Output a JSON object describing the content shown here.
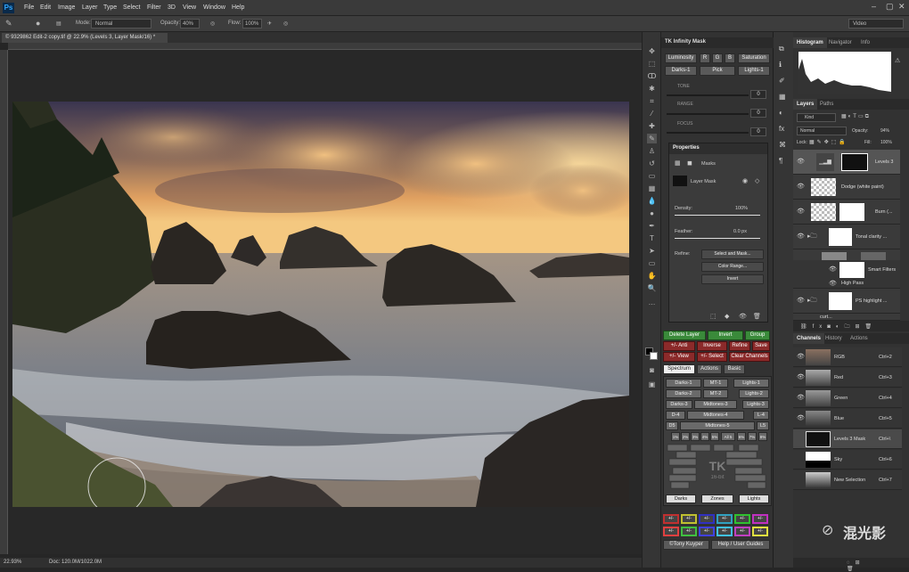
{
  "app": {
    "logo": "Ps"
  },
  "menu": [
    "File",
    "Edit",
    "Image",
    "Layer",
    "Type",
    "Select",
    "Filter",
    "3D",
    "View",
    "Window",
    "Help"
  ],
  "options": {
    "mode_label": "Mode:",
    "mode_value": "Normal",
    "opacity_label": "Opacity:",
    "opacity_value": "40%",
    "flow_label": "Flow:",
    "flow_value": "100%",
    "workspace": "Video"
  },
  "document": {
    "tab_title": "© 9329862 Edit-2 copy.tif @ 22.9% (Levels 3, Layer Mask/16) *",
    "zoom": "22.93%",
    "doc_size": "Doc: 120.0M/1022.0M"
  },
  "tk": {
    "title": "TK Infinity Mask",
    "buttons_row1": [
      "Luminosity",
      "R",
      "G",
      "B",
      "Saturation"
    ],
    "buttons_row2": [
      "Darks-1",
      "Pick",
      "Lights-1"
    ],
    "sliders": [
      {
        "label": "TONE",
        "value": "0"
      },
      {
        "label": "RANGE",
        "value": "0"
      },
      {
        "label": "FOCUS",
        "value": "0"
      }
    ],
    "action_rows": [
      [
        "Delete Layer",
        "Invert",
        "Group"
      ],
      [
        "+/- Anti",
        "Inverse",
        "Refine",
        "Save"
      ],
      [
        "+/- View",
        "+/- Select",
        "Clear Channels"
      ]
    ],
    "tabs": [
      "Spectrum",
      "Actions",
      "Basic"
    ],
    "zone_rows": [
      [
        "Darks-1",
        "MT-1",
        "Lights-1"
      ],
      [
        "Darks-2",
        "MT-2",
        "Lights-2"
      ],
      [
        "Darks-3",
        "Midtones-3",
        "Lights-3"
      ],
      [
        "D-4",
        "Midtones-4",
        "L-4"
      ],
      [
        "D5",
        "Midtones-5",
        "L5"
      ]
    ],
    "percent_row": [
      "1%",
      "2%",
      "3%",
      "4%",
      "5%",
      "All 5",
      "6%",
      "7%",
      "8%"
    ],
    "zones_footer": [
      "Darks",
      "Zones",
      "Lights"
    ],
    "watermark_logo": "TK",
    "watermark_sub": "16-bit",
    "footer": [
      "©Tony Kuyper",
      "Help / User Guides"
    ],
    "color_row1": [
      "+/-",
      "+/-",
      "+/-",
      "+/-",
      "+/-",
      "+/-"
    ],
    "color_row2": [
      "+/-",
      "+/-",
      "+/-",
      "+/-",
      "+/-",
      "+/-"
    ]
  },
  "properties": {
    "title": "Properties",
    "masks_label": "Masks",
    "layer_mask": "Layer Mask",
    "density_label": "Density:",
    "density_value": "100%",
    "feather_label": "Feather:",
    "feather_value": "0.0 px",
    "refine_label": "Refine:",
    "buttons": [
      "Select and Mask...",
      "Color Range...",
      "Invert"
    ]
  },
  "histogram": {
    "tabs": [
      "Histogram",
      "Navigator",
      "Info"
    ]
  },
  "layers": {
    "tabs": [
      "Layers",
      "Paths"
    ],
    "kind_label": "Kind",
    "blend": "Normal",
    "opacity_label": "Opacity:",
    "opacity": "94%",
    "lock_label": "Lock:",
    "fill_label": "Fill:",
    "fill": "100%",
    "items": [
      {
        "name": "Levels 3"
      },
      {
        "name": "Dodge (white paint)"
      },
      {
        "name": "Burn (..."
      },
      {
        "name": "Tonal clarity ..."
      },
      {
        "name": "Smart Filters"
      },
      {
        "name": "High Pass"
      },
      {
        "name": "PS highlight ..."
      },
      {
        "name": "curt..."
      }
    ]
  },
  "channels": {
    "tabs": [
      "Channels",
      "History",
      "Actions"
    ],
    "items": [
      {
        "name": "RGB",
        "shortcut": "Ctrl+2"
      },
      {
        "name": "Red",
        "shortcut": "Ctrl+3"
      },
      {
        "name": "Green",
        "shortcut": "Ctrl+4"
      },
      {
        "name": "Blue",
        "shortcut": "Ctrl+5"
      },
      {
        "name": "Levels 3 Mask",
        "shortcut": "Ctrl+\\"
      },
      {
        "name": "Sky",
        "shortcut": "Ctrl+6"
      },
      {
        "name": "New Selection",
        "shortcut": "Ctrl+7"
      }
    ]
  },
  "watermark": "混光影",
  "colors": {
    "accent": "#31a8ff",
    "green": "#3a8a3a",
    "red": "#8b2a2a"
  }
}
